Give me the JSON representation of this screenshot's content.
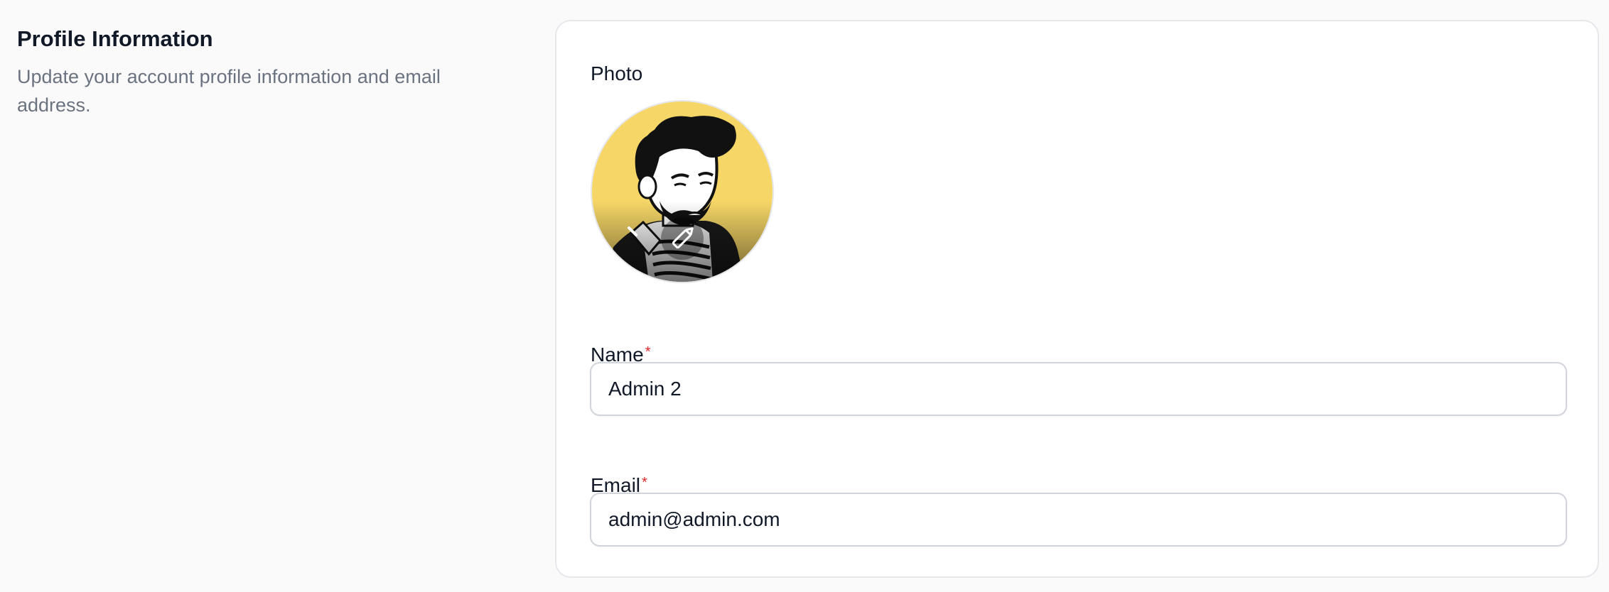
{
  "section": {
    "title": "Profile Information",
    "description": "Update your account profile information and email address."
  },
  "form": {
    "photo_label": "Photo",
    "avatar_icon": "avatar-illustration",
    "edit_icon": "pencil-icon",
    "name": {
      "label": "Name",
      "required_mark": "*",
      "value": "Admin 2"
    },
    "email": {
      "label": "Email",
      "required_mark": "*",
      "value": "admin@admin.com"
    }
  },
  "colors": {
    "background": "#fafafa",
    "card": "#ffffff",
    "avatar_bg": "#f6d667",
    "required": "#dc2626",
    "muted_text": "#6b7280"
  }
}
